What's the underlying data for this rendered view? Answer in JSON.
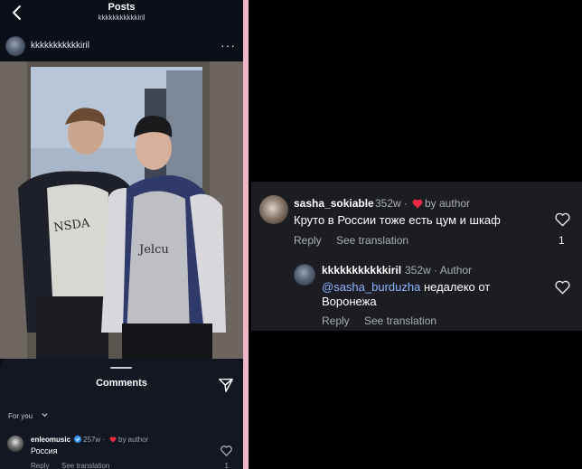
{
  "colors": {
    "accent_heart": "#ed2b45",
    "mention": "#8fb3ff",
    "verified": "#3897f0",
    "divider": "#f1b6c6"
  },
  "left": {
    "header": {
      "title": "Posts",
      "subtitle": "kkkkkkkkkkkiril",
      "back_icon": "chevron-left-icon"
    },
    "post": {
      "username": "kkkkkkkkkkkiril",
      "more_icon": "more-horizontal-icon",
      "more_label": "···"
    },
    "comments_sheet": {
      "title": "Comments",
      "share_icon": "send-icon",
      "filter_label": "For you",
      "filter_icon": "chevron-down-icon",
      "comment": {
        "username": "enleomusic",
        "verified_icon": "verified-badge-icon",
        "age": "257w ·",
        "liked_by": "by author",
        "text": "Россия",
        "reply_label": "Reply",
        "translate_label": "See translation",
        "likes": "1"
      }
    }
  },
  "right": {
    "comment": {
      "username": "sasha_sokiable",
      "age": "352w ·",
      "liked_by": "by author",
      "text": "Круто в России тоже есть цум и шкаф",
      "reply_label": "Reply",
      "translate_label": "See translation",
      "likes": "1"
    },
    "reply": {
      "username": "kkkkkkkkkkkiril",
      "meta": "352w · Author",
      "mention": "@sasha_burduzha",
      "text": " недалеко от Воронежа",
      "reply_label": "Reply",
      "translate_label": "See translation"
    }
  }
}
